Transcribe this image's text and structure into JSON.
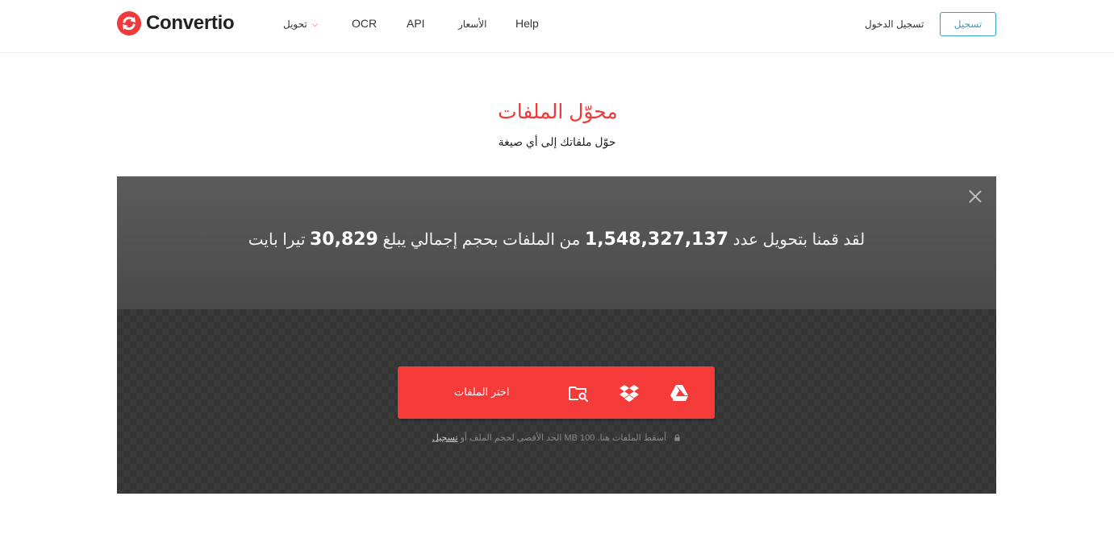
{
  "header": {
    "brand": "Convertio",
    "nav": {
      "convert": "تحويل",
      "ocr": "OCR",
      "api": "API",
      "prices": "الأسعار",
      "help": "Help"
    },
    "login": "تسجيل الدخول",
    "signup": "تسجيل"
  },
  "hero": {
    "title": "محوّل الملفات",
    "subtitle": "حوّل ملفاتك إلى أي صيغة"
  },
  "panel": {
    "stats_prefix": "لقد قمنا بتحويل عدد",
    "stats_files": "1,548,327,137",
    "stats_middle": "من الملفات بحجم إجمالي يبلغ",
    "stats_size": "30,829",
    "stats_suffix": "تيرا بايت",
    "choose_files": "اختر الملفات",
    "limit_prefix": "الحد الأقصى لحجم الملف أو",
    "limit_link": "تسجيل",
    "limit_suffix": "MB أسقط الملفات هنا. 100"
  },
  "icons": {
    "logo": "convertio-logo-icon",
    "chevron": "chevron-down-icon",
    "close": "close-icon",
    "folder_search": "folder-search-icon",
    "dropbox": "dropbox-icon",
    "google_drive": "google-drive-icon",
    "lock": "lock-icon"
  },
  "colors": {
    "brand_red": "#ee3a3a",
    "button_red": "#f53a3a",
    "signup_blue": "#3aa0c8",
    "panel_dark": "#3a3a3a"
  }
}
